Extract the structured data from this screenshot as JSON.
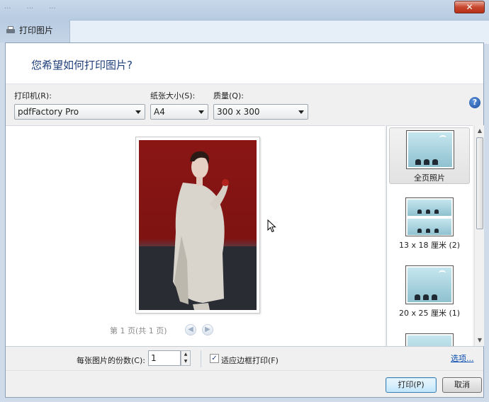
{
  "background": {
    "menu_items": [
      "...",
      "...",
      "..."
    ]
  },
  "window": {
    "title": "打印图片",
    "close_glyph": "✕"
  },
  "header": {
    "question": "您希望如何打印图片?"
  },
  "printer": {
    "label": "打印机(R):",
    "value": "pdfFactory Pro"
  },
  "paper": {
    "label": "纸张大小(S):",
    "value": "A4"
  },
  "quality": {
    "label": "质量(Q):",
    "value": "300 x 300"
  },
  "help_glyph": "?",
  "preview": {
    "page_indicator": "第 1 页(共 1 页)",
    "prev_glyph": "◀",
    "next_glyph": "▶"
  },
  "layouts": [
    {
      "label": "全页照片",
      "type": "full"
    },
    {
      "label": "13 x 18 厘米 (2)",
      "type": "double"
    },
    {
      "label": "20 x 25 厘米 (1)",
      "type": "full"
    },
    {
      "label": "",
      "type": "full"
    }
  ],
  "copies": {
    "label": "每张图片的份数(C):",
    "value": "1"
  },
  "fit_frame": {
    "label": "适应边框打印(F)",
    "checked": "✓"
  },
  "options_link": "选项...",
  "buttons": {
    "print": "打印(P)",
    "cancel": "取消"
  },
  "colors": {
    "accent_text": "#1f3f7a",
    "link": "#0b4db3",
    "photo_red": "#8a1614"
  }
}
